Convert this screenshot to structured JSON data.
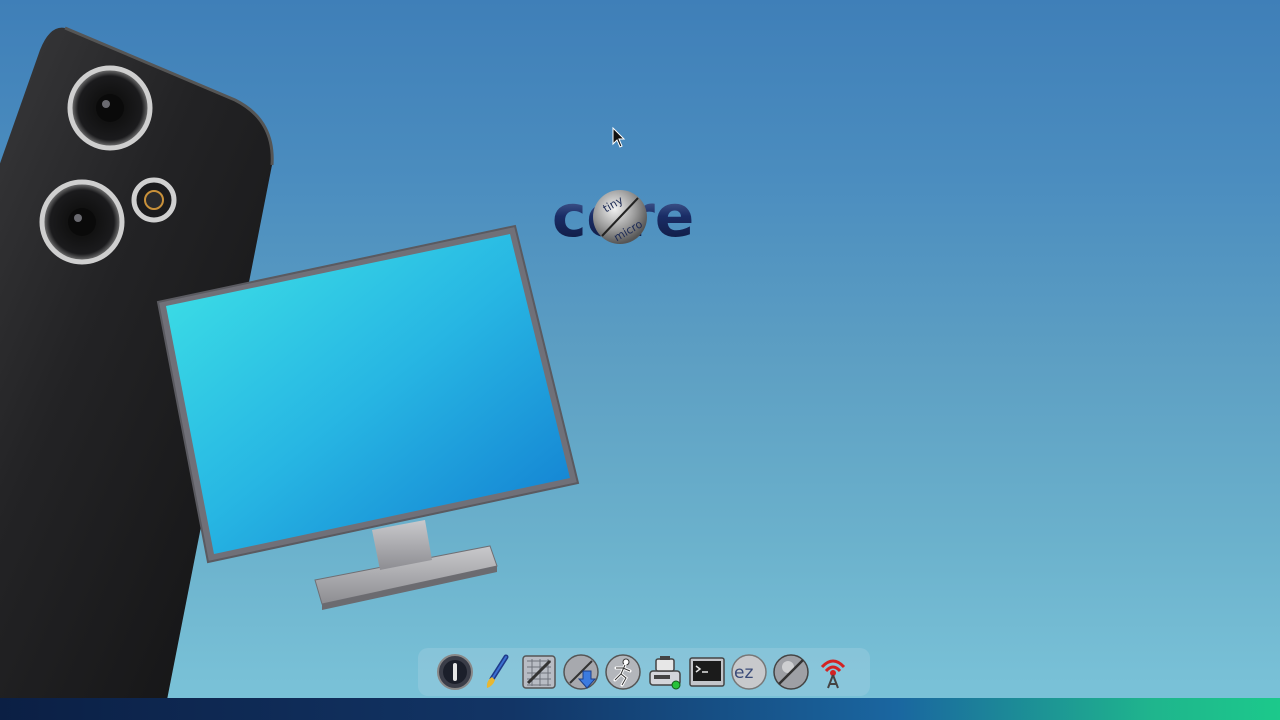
{
  "desktop": {
    "logo": {
      "text": "core",
      "sub_text_1": "tiny",
      "sub_text_2": "micro"
    }
  },
  "dock": {
    "items": [
      {
        "name": "exit",
        "icon": "power-icon"
      },
      {
        "name": "wallpaper",
        "icon": "paintbrush-icon"
      },
      {
        "name": "control-panel",
        "icon": "control-panel-icon"
      },
      {
        "name": "apps",
        "icon": "apps-install-icon"
      },
      {
        "name": "run",
        "icon": "running-man-icon"
      },
      {
        "name": "mount",
        "icon": "mount-drive-icon"
      },
      {
        "name": "terminal",
        "icon": "terminal-icon"
      },
      {
        "name": "ezremaster",
        "icon": "ezremaster-icon"
      },
      {
        "name": "tc-install",
        "icon": "tc-disc-icon"
      },
      {
        "name": "wifi",
        "icon": "wifi-tower-icon"
      }
    ],
    "ez_label": "ez"
  },
  "colors": {
    "background_top": "#3f7fb8",
    "background_bottom": "#79c1d7",
    "monitor_screen": "#2fb0e0",
    "phone_body": "#1c1c1e"
  }
}
